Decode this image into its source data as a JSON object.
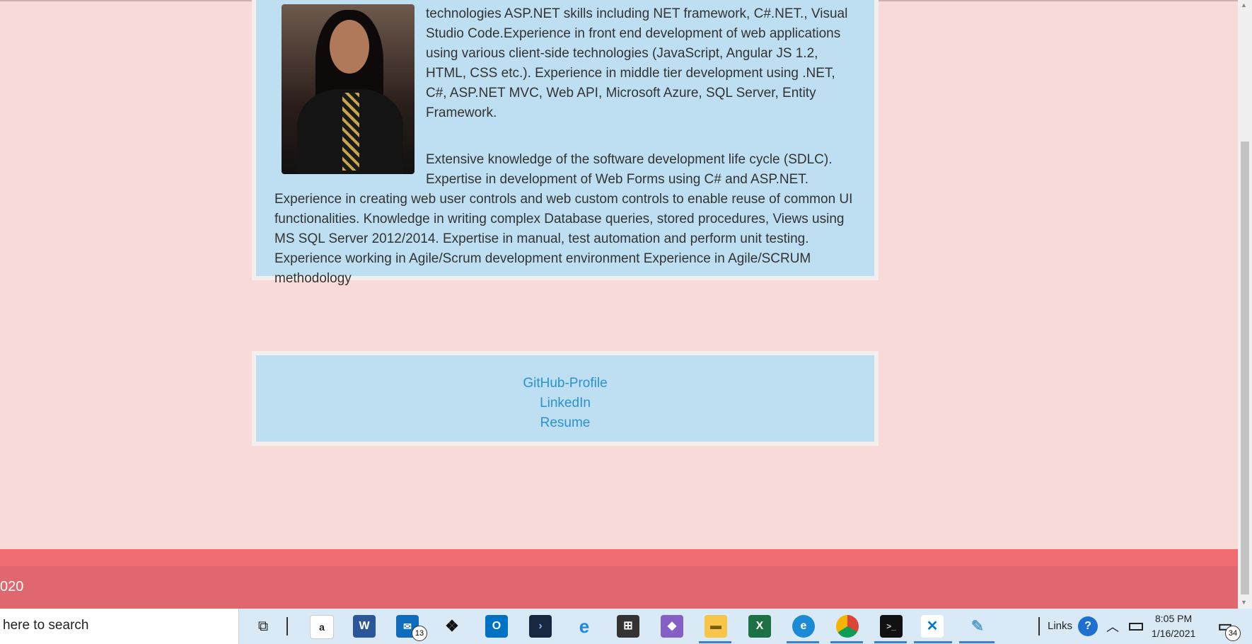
{
  "about": {
    "paragraph1": "technologies ASP.NET skills including NET framework, C#.NET., Visual Studio Code.Experience in front end development of web applications using various client-side technologies (JavaScript, Angular JS 1.2, HTML, CSS etc.). Experience in middle tier development using .NET, C#, ASP.NET MVC, Web API, Microsoft Azure, SQL Server, Entity Framework.",
    "paragraph2": "Extensive knowledge of the software development life cycle (SDLC). Expertise in development of Web Forms using C# and ASP.NET. Experience in creating web user controls and web custom controls to enable reuse of common UI functionalities. Knowledge in writing complex Database queries, stored procedures, Views using MS SQL Server 2012/2014. Expertise in manual, test automation and perform unit testing. Experience working in Agile/Scrum development environment Experience in Agile/SCRUM methodology"
  },
  "links": {
    "github": "GitHub-Profile",
    "linkedin": "LinkedIn",
    "resume": "Resume"
  },
  "footer": {
    "text": "020"
  },
  "taskbar": {
    "search_text": "here to search",
    "mail_badge": "13",
    "links_label": "Links",
    "time": "8:05 PM",
    "date": "1/16/2021",
    "notification_count": "34"
  }
}
